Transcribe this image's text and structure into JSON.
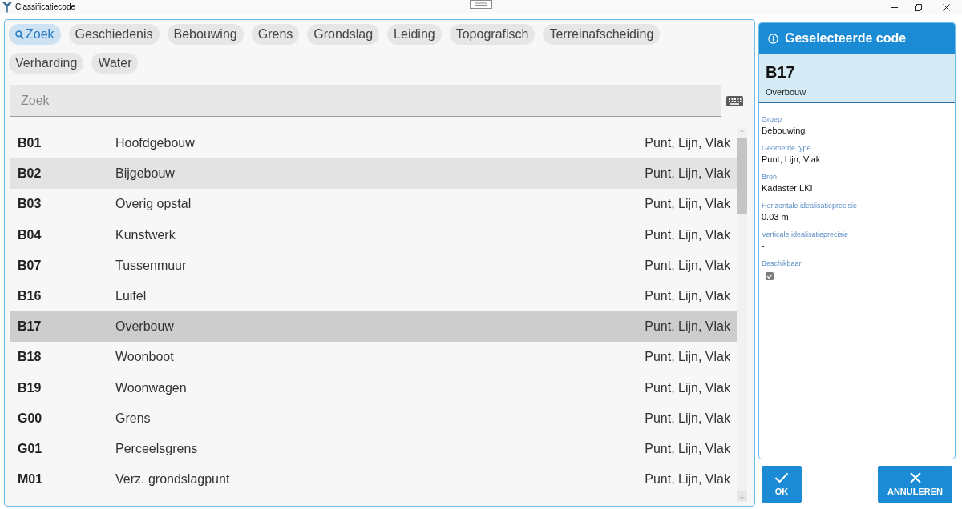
{
  "window": {
    "title": "Classificatiecode"
  },
  "tabs": [
    {
      "kind": "search",
      "label": "Zoek",
      "selected": true
    },
    {
      "kind": "group",
      "label": "Geschiedenis",
      "selected": false
    },
    {
      "kind": "group",
      "label": "Bebouwing",
      "selected": false
    },
    {
      "kind": "group",
      "label": "Grens",
      "selected": false
    },
    {
      "kind": "group",
      "label": "Grondslag",
      "selected": false
    },
    {
      "kind": "group",
      "label": "Leiding",
      "selected": false
    },
    {
      "kind": "group",
      "label": "Topografisch",
      "selected": false
    },
    {
      "kind": "group",
      "label": "Terreinafscheiding",
      "selected": false
    },
    {
      "kind": "group",
      "label": "Verharding",
      "selected": false
    },
    {
      "kind": "group",
      "label": "Water",
      "selected": false
    }
  ],
  "search": {
    "placeholder": "Zoek"
  },
  "rows": [
    {
      "code": "B01",
      "name": "Hoofdgebouw",
      "geometry": "Punt, Lijn, Vlak",
      "selected": false,
      "hovered": false
    },
    {
      "code": "B02",
      "name": "Bijgebouw",
      "geometry": "Punt, Lijn, Vlak",
      "selected": false,
      "hovered": true
    },
    {
      "code": "B03",
      "name": "Overig opstal",
      "geometry": "Punt, Lijn, Vlak",
      "selected": false,
      "hovered": false
    },
    {
      "code": "B04",
      "name": "Kunstwerk",
      "geometry": "Punt, Lijn, Vlak",
      "selected": false,
      "hovered": false
    },
    {
      "code": "B07",
      "name": "Tussenmuur",
      "geometry": "Punt, Lijn, Vlak",
      "selected": false,
      "hovered": false
    },
    {
      "code": "B16",
      "name": "Luifel",
      "geometry": "Punt, Lijn, Vlak",
      "selected": false,
      "hovered": false
    },
    {
      "code": "B17",
      "name": "Overbouw",
      "geometry": "Punt, Lijn, Vlak",
      "selected": true,
      "hovered": false
    },
    {
      "code": "B18",
      "name": "Woonboot",
      "geometry": "Punt, Lijn, Vlak",
      "selected": false,
      "hovered": false
    },
    {
      "code": "B19",
      "name": "Woonwagen",
      "geometry": "Punt, Lijn, Vlak",
      "selected": false,
      "hovered": false
    },
    {
      "code": "G00",
      "name": "Grens",
      "geometry": "Punt, Lijn, Vlak",
      "selected": false,
      "hovered": false
    },
    {
      "code": "G01",
      "name": "Perceelsgrens",
      "geometry": "Punt, Lijn, Vlak",
      "selected": false,
      "hovered": false
    },
    {
      "code": "M01",
      "name": "Verz. grondslagpunt",
      "geometry": "Punt, Lijn, Vlak",
      "selected": false,
      "hovered": false
    }
  ],
  "detail": {
    "title": "Geselecteerde code",
    "code": "B17",
    "name": "Overbouw",
    "fields": [
      {
        "kind": "text",
        "label": "Groep",
        "value": "Bebouwing"
      },
      {
        "kind": "text",
        "label": "Geometrie type",
        "value": "Punt, Lijn, Vlak"
      },
      {
        "kind": "text",
        "label": "Bron",
        "value": "Kadaster LKI"
      },
      {
        "kind": "text",
        "label": "Horizontale idealisatieprecisie",
        "value": "0.03 m"
      },
      {
        "kind": "text",
        "label": "Verticale idealisatieprecisie",
        "value": "-"
      },
      {
        "kind": "checkbox",
        "label": "Beschikbaar",
        "checked": true,
        "disabled": true
      }
    ]
  },
  "buttons": [
    {
      "kind": "ok",
      "label": "OK"
    },
    {
      "kind": "cancel",
      "label": "ANNULEREN"
    }
  ]
}
